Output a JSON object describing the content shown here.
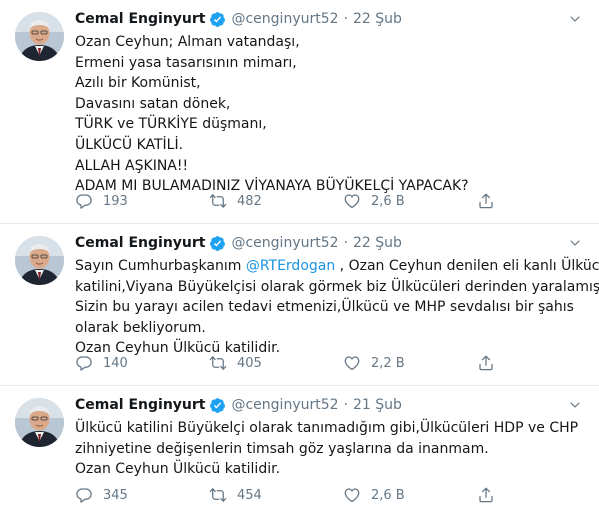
{
  "colors": {
    "accent": "#1b95e0",
    "muted": "#657786",
    "text": "#14171a",
    "divider": "#e6ecf0",
    "verified": "#1da1f2"
  },
  "tweets": [
    {
      "name": "Cemal Enginyurt",
      "handle": "@cenginyurt52",
      "dot": "·",
      "time": "22 Şub",
      "lines": [
        "Ozan Ceyhun; Alman vatandaşı,",
        "Ermeni yasa tasarısının mimarı,",
        "Azılı bir Komünist,",
        "Davasını satan dönek,",
        "TÜRK ve TÜRKİYE düşmanı,",
        "ÜLKÜCÜ KATİLİ.",
        "ALLAH AŞKINA!!",
        "ADAM MI BULAMADINIZ VİYANAYA BÜYÜKELÇİ YAPACAK?"
      ],
      "replies": "193",
      "retweets": "482",
      "likes": "2,6 B"
    },
    {
      "name": "Cemal Enginyurt",
      "handle": "@cenginyurt52",
      "dot": "·",
      "time": "22 Şub",
      "line1_pre": "Sayın Cumhurbaşkanım ",
      "line1_mention": "@RTErdogan",
      "line1_post": " , Ozan Ceyhun denilen eli kanlı  Ülkücü",
      "lines": [
        "katilini,Viyana Büyükelçisi olarak görmek biz Ülkücüleri derinden yaralamıştır.",
        "Sizin bu  yarayı acilen tedavi etmenizi,Ülkücü ve MHP sevdalısı bir şahıs",
        "olarak bekliyorum.",
        "Ozan Ceyhun Ülkücü katilidir."
      ],
      "replies": "140",
      "retweets": "405",
      "likes": "2,2 B"
    },
    {
      "name": "Cemal Enginyurt",
      "handle": "@cenginyurt52",
      "dot": "·",
      "time": "21 Şub",
      "lines": [
        "Ülkücü katilini Büyükelçi olarak tanımadığım gibi,Ülkücüleri HDP ve CHP",
        "zihniyetine değişenlerin timsah göz yaşlarına da inanmam.",
        "Ozan Ceyhun Ülkücü katilidir."
      ],
      "replies": "345",
      "retweets": "454",
      "likes": "2,6 B"
    }
  ],
  "icons": {
    "verified": "verified-badge-icon",
    "caret": "chevron-down-icon",
    "reply": "reply-icon",
    "retweet": "retweet-icon",
    "like": "heart-icon",
    "share": "share-icon"
  }
}
